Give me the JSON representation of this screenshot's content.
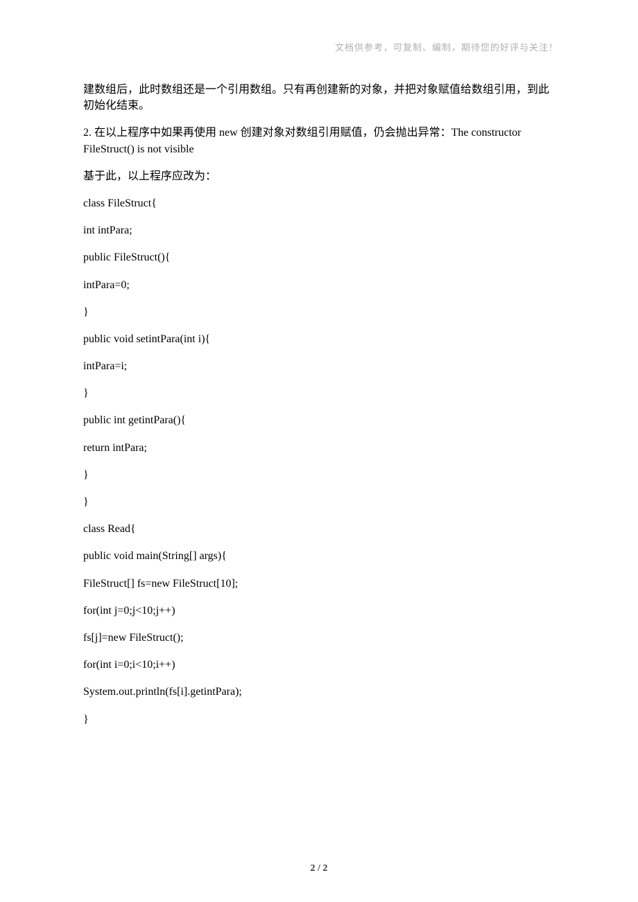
{
  "header": {
    "text": "文档供参考，可复制、编制，期待您的好评与关注！"
  },
  "paragraphs": {
    "p1": "建数组后，此时数组还是一个引用数组。只有再创建新的对象，并把对象赋值给数组引用，到此初始化结束。",
    "p2": "2. 在以上程序中如果再使用 new 创建对象对数组引用赋值，仍会抛出异常：The constructor FileStruct() is not visible",
    "p3": "基于此，以上程序应改为："
  },
  "code": {
    "l1": "class FileStruct{",
    "l2": "int intPara;",
    "l3": "public FileStruct(){",
    "l4": "intPara=0;",
    "l5": "}",
    "l6": "public void setintPara(int i){",
    "l7": "intPara=i;",
    "l8": "}",
    "l9": "public int getintPara(){",
    "l10": "return intPara;",
    "l11": "}",
    "l12": "}",
    "l13": "class Read{",
    "l14": "public void main(String[] args){",
    "l15": "FileStruct[] fs=new FileStruct[10];",
    "l16": "for(int j=0;j<10;j++)",
    "l17": "fs[j]=new FileStruct();",
    "l18": "for(int i=0;i<10;i++)",
    "l19": "System.out.println(fs[i].getintPara);",
    "l20": "}"
  },
  "footer": {
    "pageNumber": "2 / 2"
  }
}
